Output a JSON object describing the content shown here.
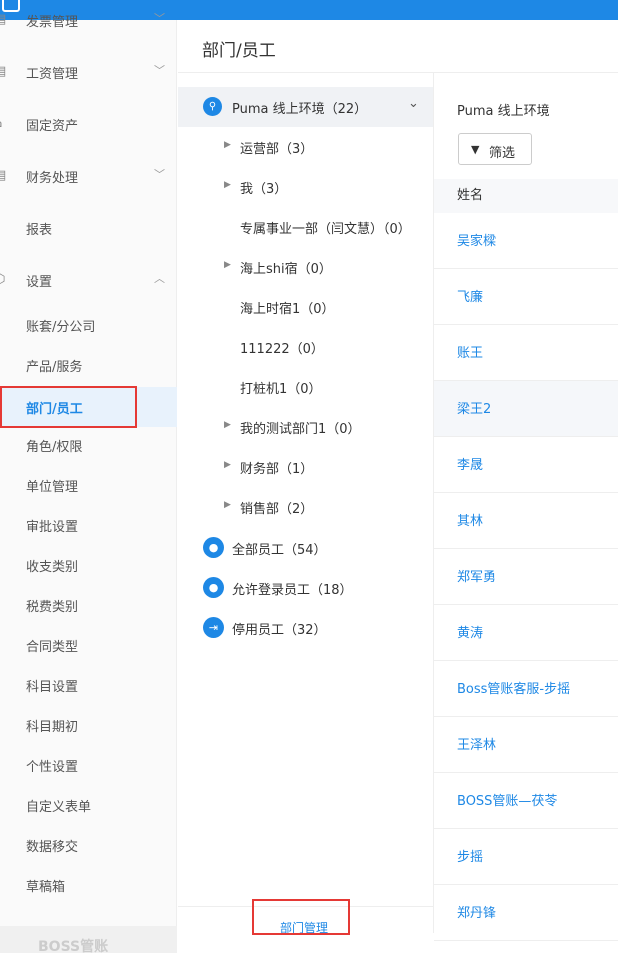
{
  "sidebar": {
    "top_items": [
      {
        "label": "发票管理",
        "icon": "invoice-icon"
      },
      {
        "label": "工资管理",
        "icon": "payroll-icon"
      },
      {
        "label": "固定资产",
        "icon": "asset-icon"
      },
      {
        "label": "财务处理",
        "icon": "finance-icon"
      },
      {
        "label": "报表",
        "icon": "report-icon"
      },
      {
        "label": "设置",
        "icon": "settings-icon"
      }
    ],
    "sub_items": [
      {
        "label": "账套/分公司"
      },
      {
        "label": "产品/服务"
      },
      {
        "label": "部门/员工"
      },
      {
        "label": "角色/权限"
      },
      {
        "label": "单位管理"
      },
      {
        "label": "审批设置"
      },
      {
        "label": "收支类别"
      },
      {
        "label": "税费类别"
      },
      {
        "label": "合同类型"
      },
      {
        "label": "科目设置"
      },
      {
        "label": "科目期初"
      },
      {
        "label": "个性设置"
      },
      {
        "label": "自定义表单"
      },
      {
        "label": "数据移交"
      },
      {
        "label": "草稿箱"
      }
    ],
    "active": "部门/员工",
    "bottom_label": "BOSS管账"
  },
  "page": {
    "title": "部门/员工"
  },
  "tree": {
    "root": {
      "label": "Puma 线上环境（22）"
    },
    "nodes": [
      {
        "label": "运营部（3）",
        "expandable": true
      },
      {
        "label": "我（3）",
        "expandable": true
      },
      {
        "label": "专属事业一部（闫文慧）（0）",
        "expandable": false
      },
      {
        "label": "海上shi宿（0）",
        "expandable": true
      },
      {
        "label": "海上时宿1（0）",
        "expandable": false
      },
      {
        "label": "111222（0）",
        "expandable": false
      },
      {
        "label": "打桩机1（0）",
        "expandable": false
      },
      {
        "label": "我的测试部门1（0）",
        "expandable": true
      },
      {
        "label": "财务部（1）",
        "expandable": true
      },
      {
        "label": "销售部（2）",
        "expandable": true
      }
    ],
    "groups": [
      {
        "label": "全部员工（54）",
        "icon": "user-icon"
      },
      {
        "label": "允许登录员工（18）",
        "icon": "user-icon"
      },
      {
        "label": "停用员工（32）",
        "icon": "exit-icon"
      }
    ],
    "footer_link": "部门管理"
  },
  "employees": {
    "org_title": "Puma 线上环境",
    "filter_label": "筛选",
    "column_header": "姓名",
    "names": [
      "吴家樑",
      "飞廉",
      "账王",
      "梁王2",
      "李晟",
      "其林",
      "郑军勇",
      "黄涛",
      "Boss管账客服-步摇",
      "王泽林",
      "BOSS管账—茯苓",
      "步摇",
      "郑丹锋"
    ]
  }
}
